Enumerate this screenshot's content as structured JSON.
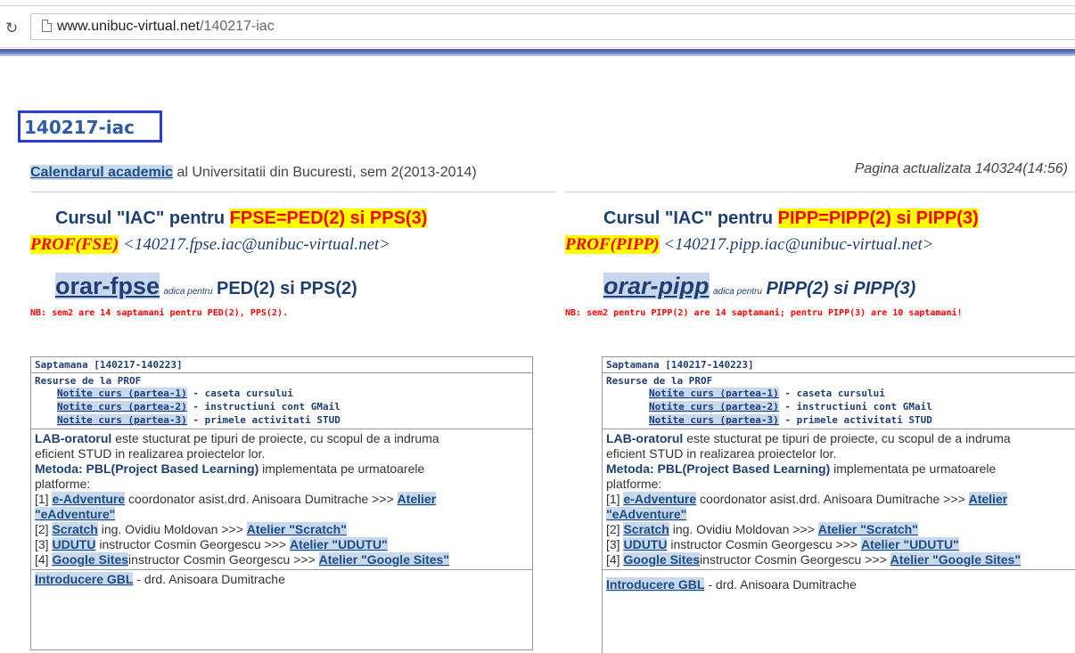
{
  "browser": {
    "url_host": "www.unibuc-virtual.net",
    "url_path": "/140217-iac"
  },
  "page": {
    "title": "140217-iac",
    "calendar_link": "Calendarul academic",
    "calendar_rest": " al Universitatii din Bucuresti, sem 2(2013-2014)",
    "updated": "Pagina actualizata 140324(14:56)"
  },
  "left": {
    "course_prefix": "Cursul \"IAC\" pentru ",
    "course_hl": "FPSE=PED(2) si PPS(3)",
    "prof_tag": "PROF(FSE)",
    "prof_email": " <140217.fpse.iac@unibuc-virtual.net>",
    "orar_link": "orar-fpse",
    "orar_small": "adica pentru",
    "orar_groups": "PED(2) si PPS(2)",
    "nb": "NB: sem2 are 14 saptamani pentru PED(2), PPS(2).",
    "week": "Saptamana [140217-140223]",
    "resources_title": "Resurse de la PROF",
    "notes": [
      {
        "link": "Notite curs (partea-1)",
        "desc": " - caseta cursului"
      },
      {
        "link": "Notite curs (partea-2)",
        "desc": " - instructiuni cont GMail"
      },
      {
        "link": "Notite curs (partea-3)",
        "desc": " - primele activitati STUD"
      }
    ],
    "lab_bold": "LAB-oratorul",
    "lab_line1": " este stucturat pe tipuri de proiecte, cu scopul de a indruma",
    "lab_line2": "eficient STUD in realizarea proiectelor lor.",
    "metoda_bold": "Metoda: PBL(Project Based Learning)",
    "metoda_line1": " implementata pe urmatoarele",
    "metoda_line2": "platforme:",
    "platforms": [
      {
        "num": "[1] ",
        "link": "e-Adventure",
        "mid": " coordonator asist.drd. Anisoara Dumitrache >>> ",
        "atelier1": "Atelier",
        "atelier2": "\"eAdventure\""
      },
      {
        "num": "[2] ",
        "link": "Scratch",
        "mid": " ing. Ovidiu Moldovan >>> ",
        "atelier1": "Atelier \"Scratch\""
      },
      {
        "num": "[3] ",
        "link": "UDUTU",
        "mid": " instructor Cosmin Georgescu >>> ",
        "atelier1": "Atelier \"UDUTU\""
      },
      {
        "num": "[4] ",
        "link": "Google Sites",
        "mid": "instructor Cosmin Georgescu >>> ",
        "atelier1": "Atelier \"Google Sites\""
      }
    ],
    "intro_link": "Introducere GBL",
    "intro_rest": " - drd. Anisoara Dumitrache"
  },
  "right": {
    "course_prefix": "Cursul \"IAC\" pentru ",
    "course_hl": "PIPP=PIPP(2) si PIPP(3)",
    "prof_tag": "PROF(PIPP)",
    "prof_email": " <140217.pipp.iac@unibuc-virtual.net>",
    "orar_link": "orar-pipp",
    "orar_small": "adica pentru",
    "orar_groups": "PIPP(2) si PIPP(3)",
    "nb": "NB: sem2 pentru PIPP(2) are 14 saptamani; pentru PIPP(3) are 10 saptamani!",
    "week": "Saptamana [140217-140223]",
    "resources_title": "Resurse de la PROF",
    "notes": [
      {
        "link": "Notite curs (partea-1)",
        "desc": " - caseta cursului"
      },
      {
        "link": "Notite curs (partea-2)",
        "desc": " - instructiuni cont GMail"
      },
      {
        "link": "Notite curs (partea-3)",
        "desc": " - primele activitati STUD"
      }
    ],
    "lab_bold": "LAB-oratorul",
    "lab_line1": " este stucturat pe tipuri de proiecte, cu scopul de a indruma",
    "lab_line2": "eficient STUD in realizarea proiectelor lor.",
    "metoda_bold": "Metoda: PBL(Project Based Learning)",
    "metoda_line1": " implementata pe urmatoarele",
    "metoda_line2": "platforme:",
    "platforms": [
      {
        "num": "[1] ",
        "link": "e-Adventure",
        "mid": " coordonator asist.drd. Anisoara Dumitrache >>> ",
        "atelier1": "Atelier",
        "atelier2": "\"eAdventure\""
      },
      {
        "num": "[2] ",
        "link": "Scratch",
        "mid": " ing. Ovidiu Moldovan >>> ",
        "atelier1": "Atelier \"Scratch\""
      },
      {
        "num": "[3] ",
        "link": "UDUTU",
        "mid": " instructor Cosmin Georgescu >>> ",
        "atelier1": "Atelier \"UDUTU\""
      },
      {
        "num": "[4] ",
        "link": "Google Sites",
        "mid": "instructor Cosmin Georgescu >>> ",
        "atelier1": "Atelier \"Google Sites\""
      }
    ],
    "intro_link": "Introducere GBL",
    "intro_rest": " - drd. Anisoara Dumitrache"
  }
}
